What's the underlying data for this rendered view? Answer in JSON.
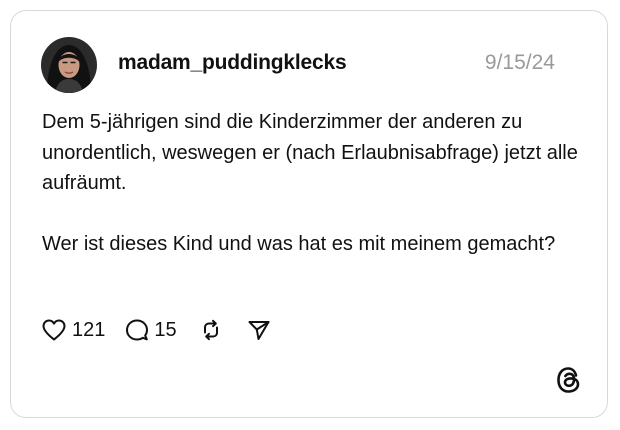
{
  "post": {
    "author": {
      "username": "madam_puddingklecks",
      "avatar_icon": "profile-photo"
    },
    "date": "9/15/24",
    "paragraphs": [
      "Dem 5-jährigen sind die Kinderzimmer der anderen zu unordentlich, weswegen er (nach Erlaubnisabfrage) jetzt alle aufräumt.",
      "Wer ist dieses Kind und was hat es mit meinem gemacht?"
    ]
  },
  "actions": {
    "likes": "121",
    "replies": "15",
    "like_icon": "heart-icon",
    "reply_icon": "speech-bubble-icon",
    "repost_icon": "repost-icon",
    "share_icon": "send-icon"
  },
  "brand": {
    "logo_icon": "threads-logo-icon"
  },
  "colors": {
    "text": "#111111",
    "muted": "#9a9a9a",
    "border": "#d9d9d9",
    "background": "#ffffff"
  }
}
